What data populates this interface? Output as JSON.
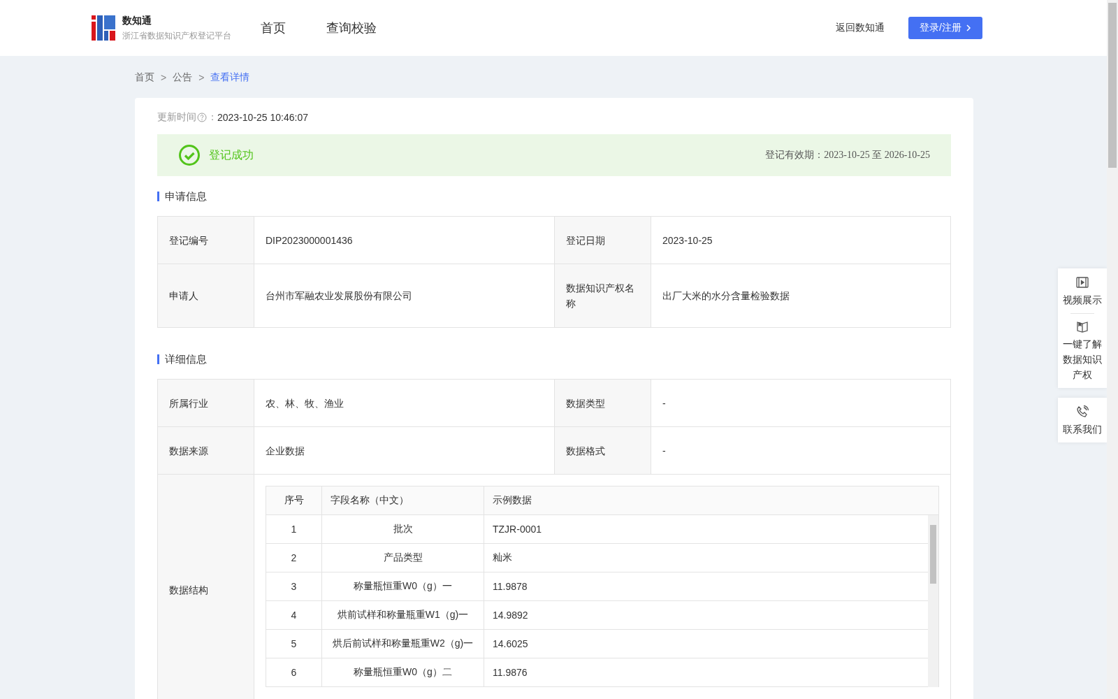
{
  "header": {
    "brand": "数知通",
    "subtitle": "浙江省数据知识产权登记平台",
    "nav": [
      {
        "label": "首页",
        "selected": false
      },
      {
        "label": "查询校验",
        "selected": false
      }
    ],
    "back_link": "返回数知通",
    "login_button": "登录/注册"
  },
  "breadcrumb": [
    {
      "label": "首页",
      "selected": false
    },
    {
      "label": "公告",
      "selected": false
    },
    {
      "label": "查看详情",
      "selected": true
    }
  ],
  "breadcrumb_separator": ">",
  "update_time": {
    "label": "更新时间",
    "colon": "：",
    "value": "2023-10-25 10:46:07"
  },
  "status": {
    "text": "登记成功",
    "validity_label": "登记有效期：",
    "validity_from": "2023-10-25",
    "validity_to_word": "至",
    "validity_to": "2026-10-25"
  },
  "application_info": {
    "title": "申请信息",
    "rows": [
      {
        "label_1": "登记编号",
        "value_1": "DIP2023000001436",
        "label_2": "登记日期",
        "value_2": "2023-10-25"
      },
      {
        "label_1": "申请人",
        "value_1": "台州市军融农业发展股份有限公司",
        "label_2": "数据知识产权名称",
        "value_2": "出厂大米的水分含量检验数据"
      }
    ]
  },
  "detail_info": {
    "title": "详细信息",
    "rows": [
      {
        "label_1": "所属行业",
        "value_1": "农、林、牧、渔业",
        "label_2": "数据类型",
        "value_2": "-"
      },
      {
        "label_1": "数据来源",
        "value_1": "企业数据",
        "label_2": "数据格式",
        "value_2": "-"
      }
    ],
    "structure": {
      "label": "数据结构",
      "columns": [
        "序号",
        "字段名称（中文）",
        "示例数据"
      ],
      "rows": [
        [
          "1",
          "批次",
          "TZJR-0001"
        ],
        [
          "2",
          "产品类型",
          "籼米"
        ],
        [
          "3",
          "称量瓶恒重W0（g）一",
          "11.9878"
        ],
        [
          "4",
          "烘前试样和称量瓶重W1（g)一",
          "14.9892"
        ],
        [
          "5",
          "烘后前试样和称量瓶重W2（g)一",
          "14.6025"
        ],
        [
          "6",
          "称量瓶恒重W0（g）二",
          "11.9876"
        ]
      ]
    }
  },
  "side_panel": [
    {
      "kind": "video",
      "label": "视频展示"
    },
    {
      "kind": "book",
      "label": "一键了解数据知识产权"
    },
    {
      "kind": "phone",
      "label": "联系我们"
    }
  ]
}
